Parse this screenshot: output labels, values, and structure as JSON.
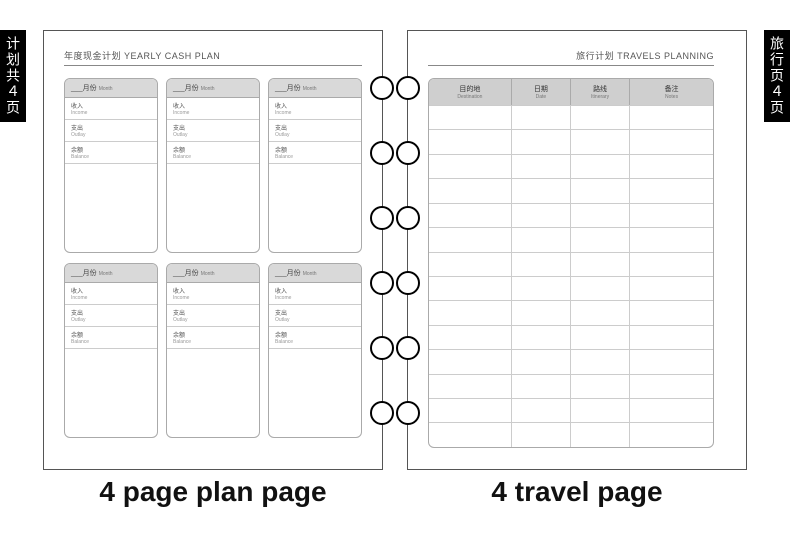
{
  "tabs": {
    "left": "计划共４页",
    "right": "旅行页４页"
  },
  "plan": {
    "title_cn": "年度现金计划",
    "title_en": "YEARLY CASH PLAN",
    "card": {
      "month_cn": "___月份",
      "month_en": "Month",
      "rows": [
        {
          "cn": "收入",
          "en": "Income"
        },
        {
          "cn": "支出",
          "en": "Outlay"
        },
        {
          "cn": "余额",
          "en": "Balance"
        }
      ]
    },
    "caption": "4 page plan page"
  },
  "travel": {
    "title_cn": "旅行计划",
    "title_en": "TRAVELS PLANNING",
    "columns": [
      {
        "cn": "目的地",
        "en": "Destination"
      },
      {
        "cn": "日期",
        "en": "Date"
      },
      {
        "cn": "路线",
        "en": "Itinerary"
      },
      {
        "cn": "备注",
        "en": "Notes"
      }
    ],
    "row_count": 14,
    "caption": "4 travel page"
  },
  "ring_count": 6
}
